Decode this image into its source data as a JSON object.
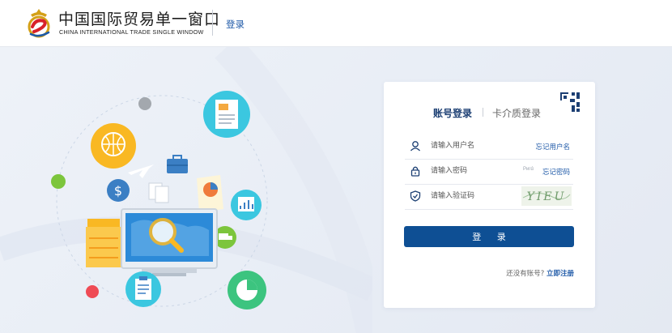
{
  "header": {
    "title": "中国国际贸易单一窗口",
    "subtitle": "CHINA INTERNATIONAL TRADE SINGLE WINDOW",
    "login_link": "登录"
  },
  "login": {
    "tabs": [
      {
        "label": "账号登录",
        "active": true
      },
      {
        "label": "卡介质登录",
        "active": false
      }
    ],
    "username": {
      "placeholder": "请输入用户名",
      "link": "忘记用户名"
    },
    "password": {
      "placeholder": "请输入密码",
      "strength": "Ригά",
      "link": "忘记密码"
    },
    "captcha": {
      "placeholder": "请输入验证码",
      "code": "YIEU"
    },
    "submit_label": "登 录",
    "no_account_text": "还没有账号?",
    "register_label": "立即注册"
  },
  "colors": {
    "brand_blue": "#0e4f94",
    "link_blue": "#1f5aa8",
    "tab_active": "#1c3f73"
  }
}
